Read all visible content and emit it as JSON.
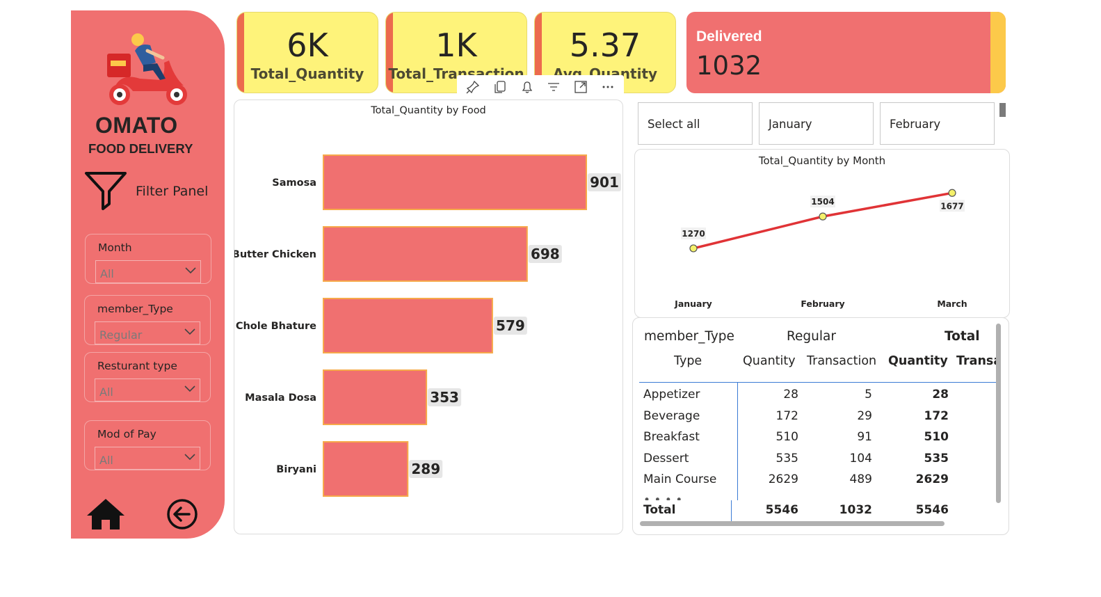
{
  "brand": {
    "name": "OMATO",
    "subtitle": "FOOD DELIVERY"
  },
  "filter_panel": {
    "title": "Filter Panel",
    "slicers": [
      {
        "label": "Month",
        "value": "All"
      },
      {
        "label": "member_Type",
        "value": "Regular"
      },
      {
        "label": "Resturant type",
        "value": "All"
      },
      {
        "label": "Mod of Pay",
        "value": "All"
      }
    ]
  },
  "kpis": [
    {
      "value": "6K",
      "label": "Total_Quantity"
    },
    {
      "value": "1K",
      "label": "Total_Transaction"
    },
    {
      "value": "5.37",
      "label": "Avg_Quantity"
    }
  ],
  "delivered": {
    "title": "Delivered",
    "value": "1032"
  },
  "month_tiles": [
    "Select all",
    "January",
    "February"
  ],
  "colors": {
    "sidebar": "#f07070",
    "kpi_bg": "#fef37a",
    "bar": "#f07070",
    "bar_border": "#f6a94a",
    "line": "#e03336",
    "marker": "#f4f06a"
  },
  "icons": [
    "scooter-rider-icon",
    "filter-funnel-icon",
    "home-icon",
    "back-arrow-icon",
    "pin-icon",
    "copy-icon",
    "bell-icon",
    "filter-icon",
    "focus-mode-icon",
    "more-options-icon",
    "chevron-down-icon"
  ],
  "chart_data": [
    {
      "type": "bar",
      "orientation": "horizontal",
      "title": "Total_Quantity by Food",
      "categories": [
        "Samosa",
        "Butter Chicken",
        "Chole Bhature",
        "Masala Dosa",
        "Biryani"
      ],
      "values": [
        901,
        698,
        579,
        353,
        289
      ],
      "data_labels": true
    },
    {
      "type": "line",
      "title": "Total_Quantity by Month",
      "categories": [
        "January",
        "February",
        "March"
      ],
      "values": [
        1270,
        1504,
        1677
      ],
      "data_labels": true,
      "ylim": [
        1050,
        1750
      ]
    }
  ],
  "matrix": {
    "header_row1": {
      "field": "member_Type",
      "group": "Regular",
      "total": "Total"
    },
    "header_row2": {
      "row_field": "Type",
      "col1": "Quantity",
      "col2": "Transaction",
      "col3": "Quantity",
      "col4": "Transa"
    },
    "rows": [
      {
        "type": "Appetizer",
        "qty": "28",
        "trans": "5",
        "total_qty": "28"
      },
      {
        "type": "Beverage",
        "qty": "172",
        "trans": "29",
        "total_qty": "172"
      },
      {
        "type": "Breakfast",
        "qty": "510",
        "trans": "91",
        "total_qty": "510"
      },
      {
        "type": "Dessert",
        "qty": "535",
        "trans": "104",
        "total_qty": "535"
      },
      {
        "type": "Main Course",
        "qty": "2629",
        "trans": "489",
        "total_qty": "2629"
      }
    ],
    "total_row": {
      "type": "Total",
      "qty": "5546",
      "trans": "1032",
      "total_qty": "5546"
    }
  }
}
